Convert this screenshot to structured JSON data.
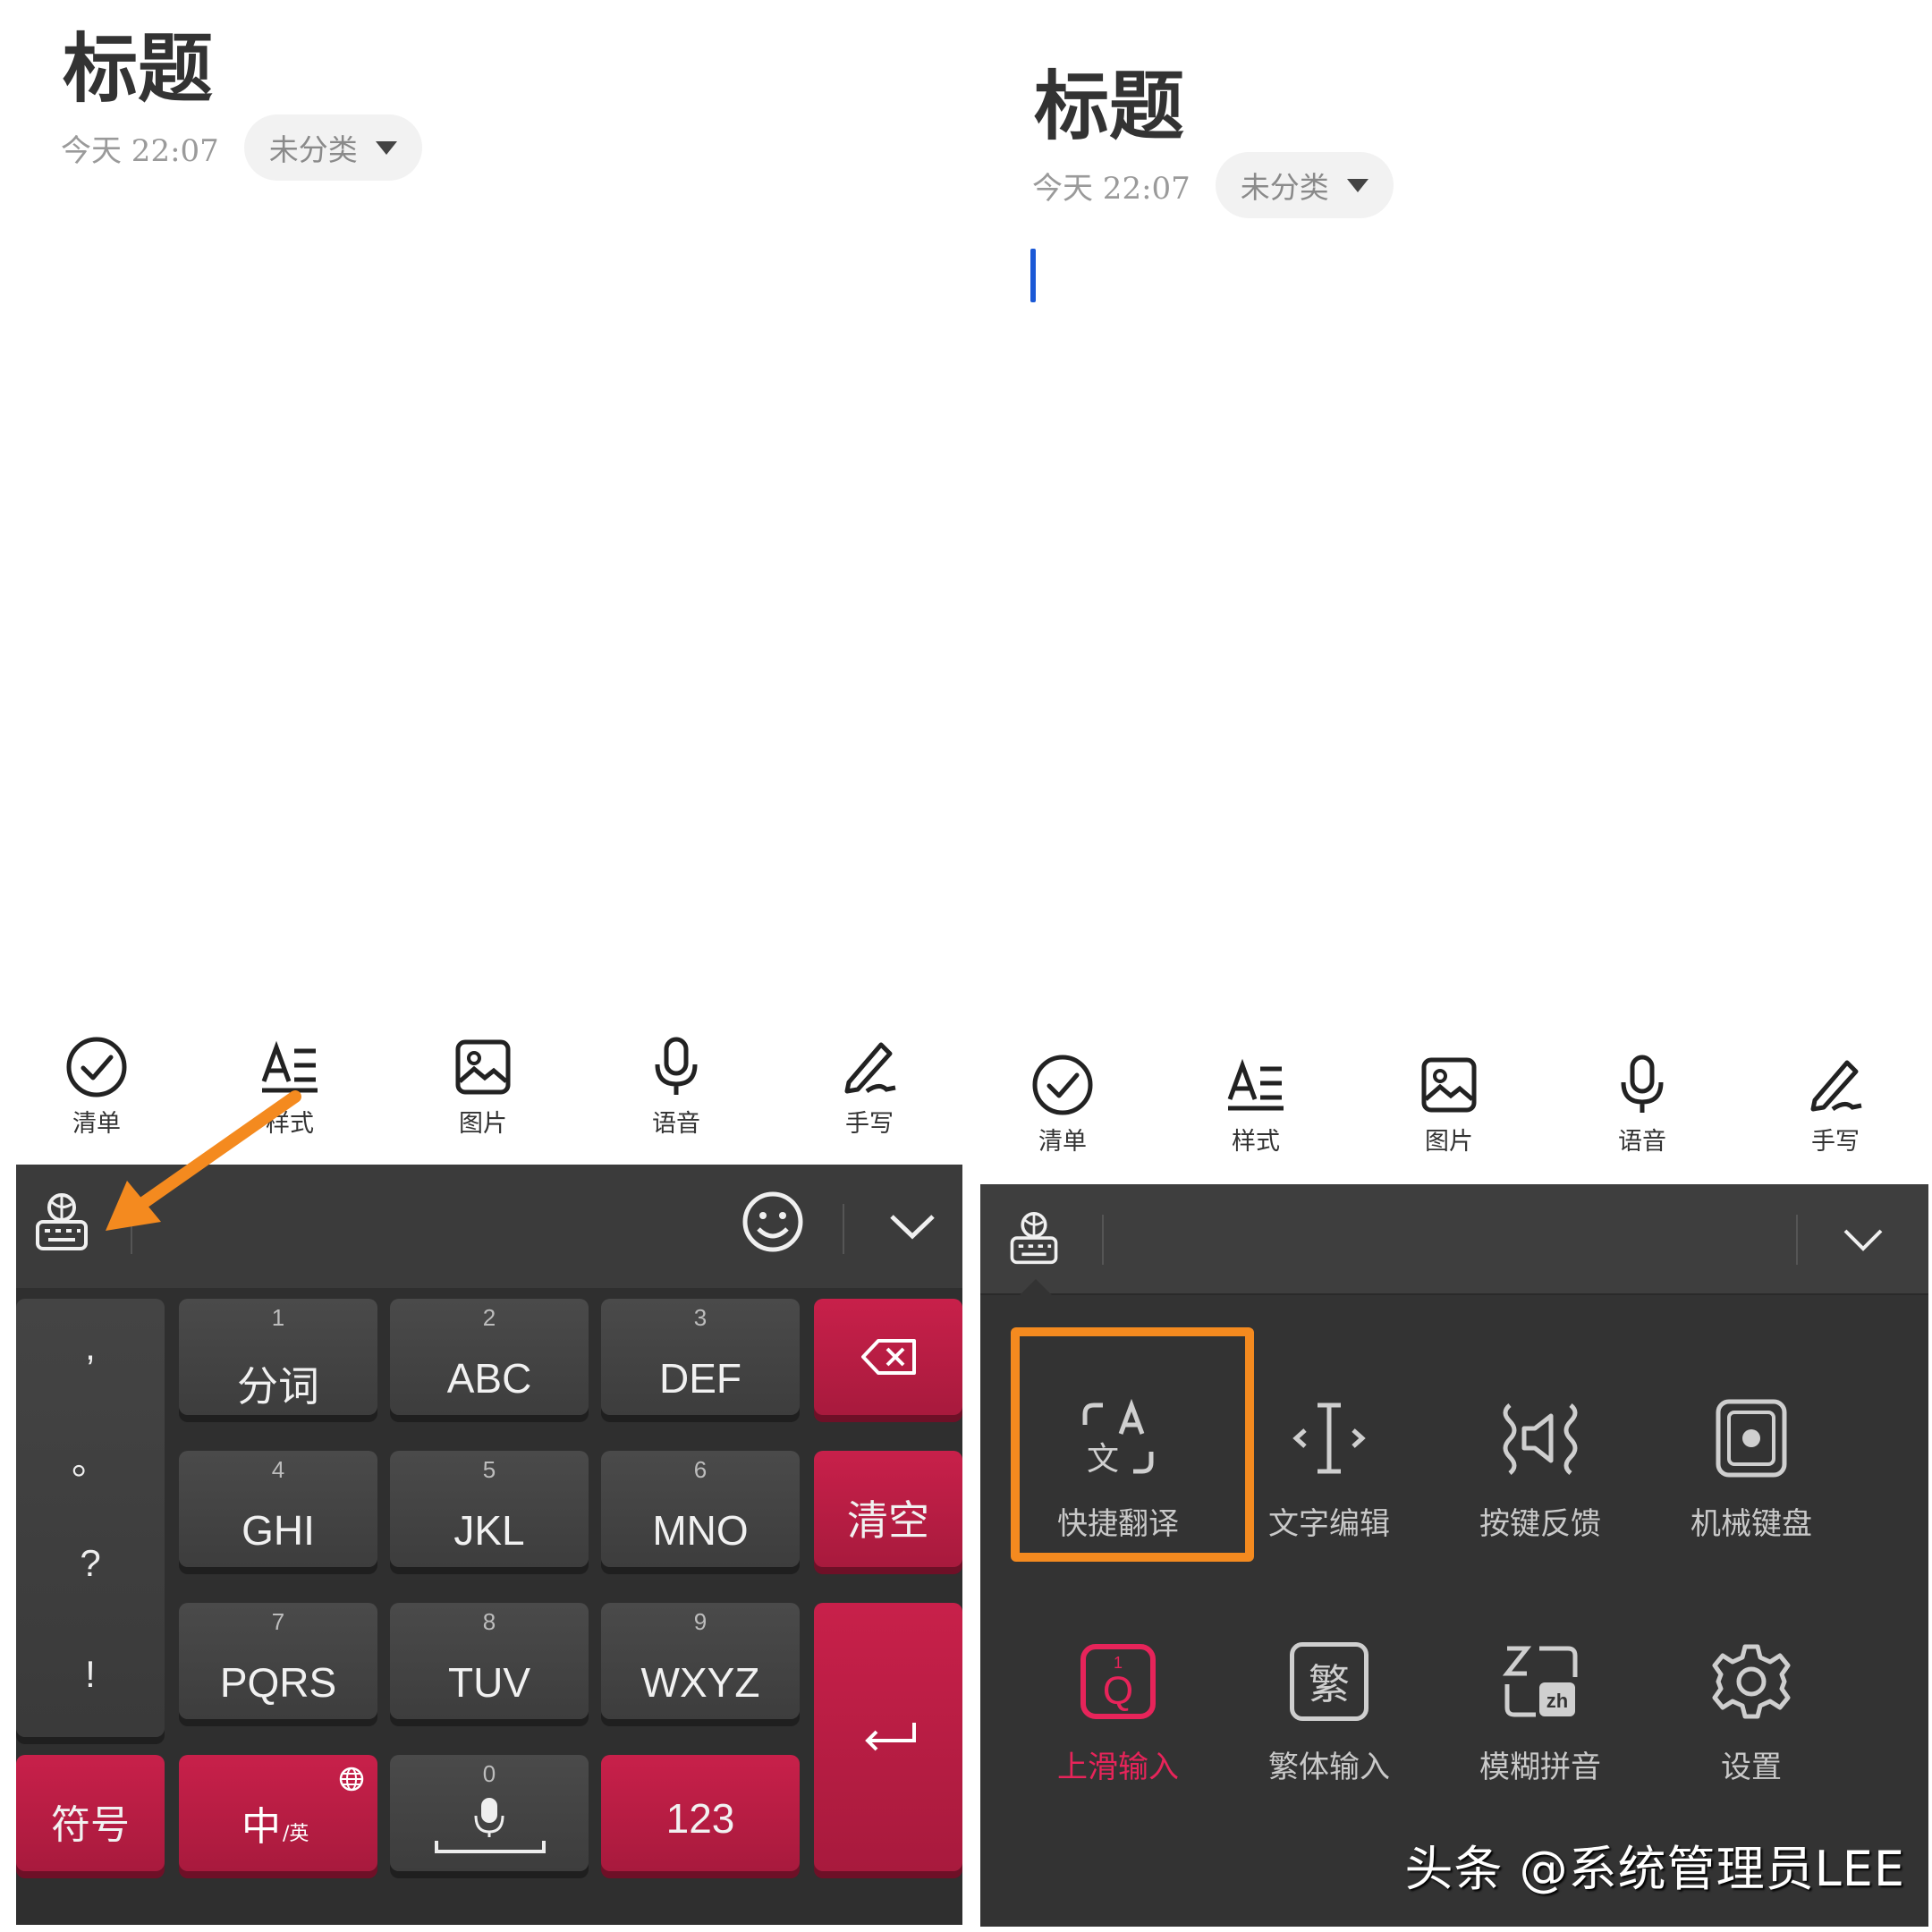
{
  "left": {
    "note": {
      "title": "标题",
      "time": "今天 22:07",
      "category": "未分类"
    },
    "toolbar": [
      "清单",
      "样式",
      "图片",
      "语音",
      "手写"
    ],
    "keyboard": {
      "punctuation": [
        ",",
        "。",
        "?",
        "!"
      ],
      "keys": [
        {
          "num": "1",
          "label": "分词"
        },
        {
          "num": "2",
          "label": "ABC"
        },
        {
          "num": "3",
          "label": "DEF"
        },
        {
          "num": "4",
          "label": "GHI"
        },
        {
          "num": "5",
          "label": "JKL"
        },
        {
          "num": "6",
          "label": "MNO"
        },
        {
          "num": "7",
          "label": "PQRS"
        },
        {
          "num": "8",
          "label": "TUV"
        },
        {
          "num": "9",
          "label": "WXYZ"
        }
      ],
      "clear": "清空",
      "symbols": "符号",
      "lang_main": "中",
      "lang_sub": "/英",
      "space_num": "0",
      "numbers": "123"
    }
  },
  "right": {
    "note": {
      "title": "标题",
      "time": "今天 22:07",
      "category": "未分类"
    },
    "toolbar": [
      "清单",
      "样式",
      "图片",
      "语音",
      "手写"
    ],
    "menu": [
      {
        "label": "快捷翻译",
        "icon": "translate-icon"
      },
      {
        "label": "文字编辑",
        "icon": "text-cursor-icon"
      },
      {
        "label": "按键反馈",
        "icon": "speaker-icon"
      },
      {
        "label": "机械键盘",
        "icon": "mechanical-key-icon"
      },
      {
        "label": "上滑输入",
        "icon": "swipe-up-icon",
        "active": true
      },
      {
        "label": "繁体输入",
        "icon": "traditional-icon",
        "glyph": "繁"
      },
      {
        "label": "模糊拼音",
        "icon": "fuzzy-pinyin-icon"
      },
      {
        "label": "设置",
        "icon": "gear-icon"
      }
    ]
  },
  "watermark": "头条 @系统管理员LEE",
  "colors": {
    "accent_red": "#c8204a",
    "highlight_orange": "#f48a1f",
    "cursor_blue": "#1b59d6"
  }
}
